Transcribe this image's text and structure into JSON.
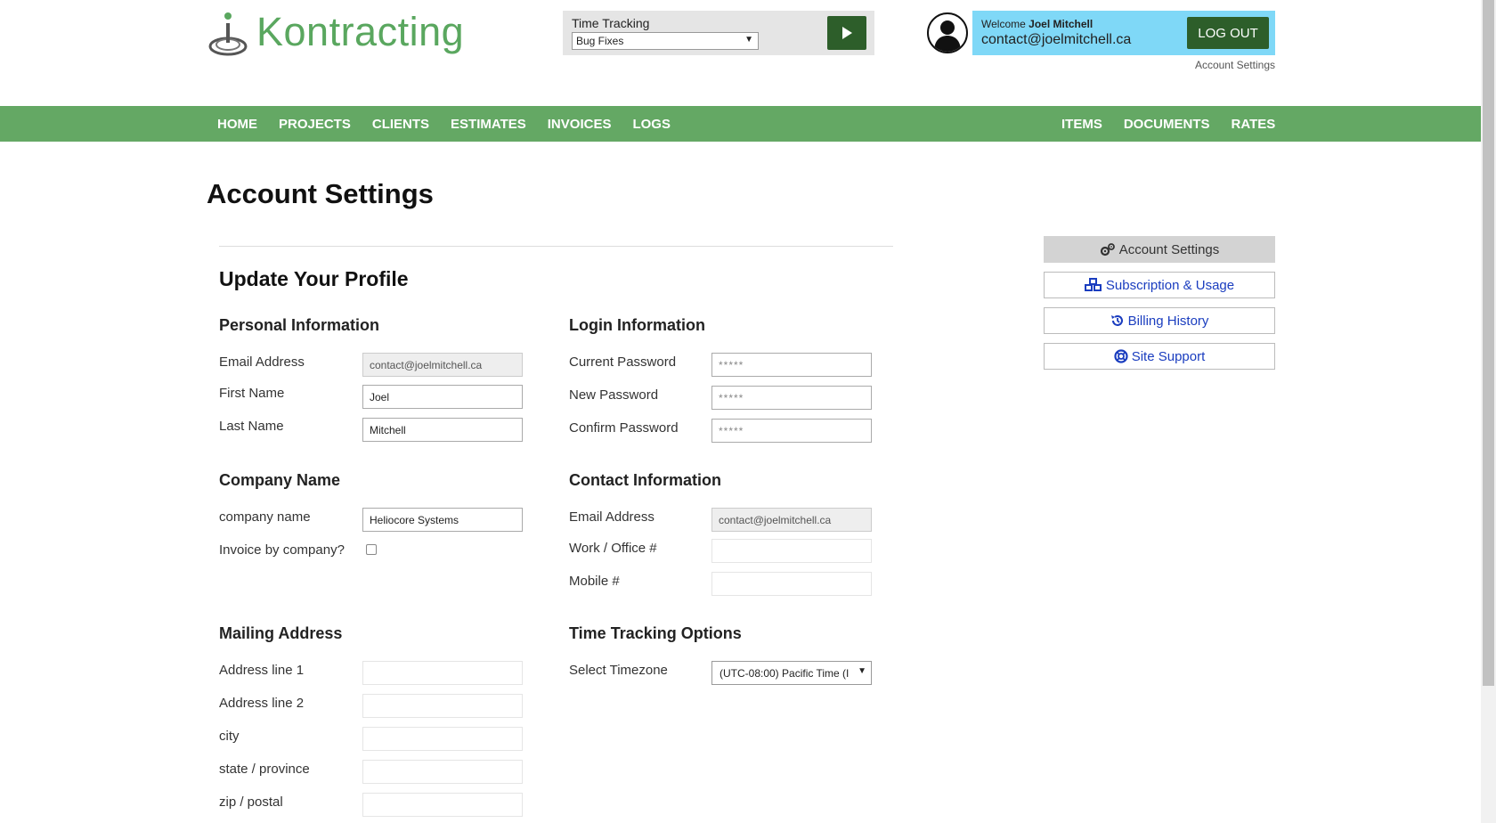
{
  "brand": {
    "name": "Kontracting"
  },
  "time_tracking": {
    "label": "Time Tracking",
    "selected": "Bug Fixes"
  },
  "user": {
    "welcome_prefix": "Welcome",
    "name": "Joel Mitchell",
    "email": "contact@joelmitchell.ca",
    "logout_label": "LOG OUT",
    "account_settings_link": "Account Settings"
  },
  "nav": {
    "left": [
      "HOME",
      "PROJECTS",
      "CLIENTS",
      "ESTIMATES",
      "INVOICES",
      "LOGS"
    ],
    "right": [
      "ITEMS",
      "DOCUMENTS",
      "RATES"
    ]
  },
  "page": {
    "title": "Account Settings",
    "section_title": "Update Your Profile"
  },
  "personal": {
    "heading": "Personal Information",
    "email_label": "Email Address",
    "email_value": "contact@joelmitchell.ca",
    "first_label": "First Name",
    "first_value": "Joel",
    "last_label": "Last Name",
    "last_value": "Mitchell"
  },
  "login": {
    "heading": "Login Information",
    "current_label": "Current Password",
    "current_value": "*****",
    "new_label": "New Password",
    "new_value": "*****",
    "confirm_label": "Confirm Password",
    "confirm_value": "*****"
  },
  "company": {
    "heading": "Company Name",
    "name_label": "company name",
    "name_value": "Heliocore Systems",
    "invoice_label": "Invoice by company?"
  },
  "contact": {
    "heading": "Contact Information",
    "email_label": "Email Address",
    "email_value": "contact@joelmitchell.ca",
    "work_label": "Work / Office #",
    "work_value": "",
    "mobile_label": "Mobile #",
    "mobile_value": ""
  },
  "mailing": {
    "heading": "Mailing Address",
    "line1_label": "Address line 1",
    "line1_value": "",
    "line2_label": "Address line 2",
    "line2_value": "",
    "city_label": "city",
    "city_value": "",
    "state_label": "state / province",
    "state_value": "",
    "zip_label": "zip / postal",
    "zip_value": ""
  },
  "time_options": {
    "heading": "Time Tracking Options",
    "timezone_label": "Select Timezone",
    "timezone_value": "(UTC-08:00) Pacific Time (I"
  },
  "side_menu": {
    "account_settings": "Account Settings",
    "subscription": "Subscription & Usage",
    "billing": "Billing History",
    "support": "Site Support"
  },
  "colors": {
    "nav_green": "#64a864",
    "dark_green": "#2d5e2a",
    "welcome_blue": "#7fd8f7",
    "link_blue": "#1a3dbf"
  }
}
